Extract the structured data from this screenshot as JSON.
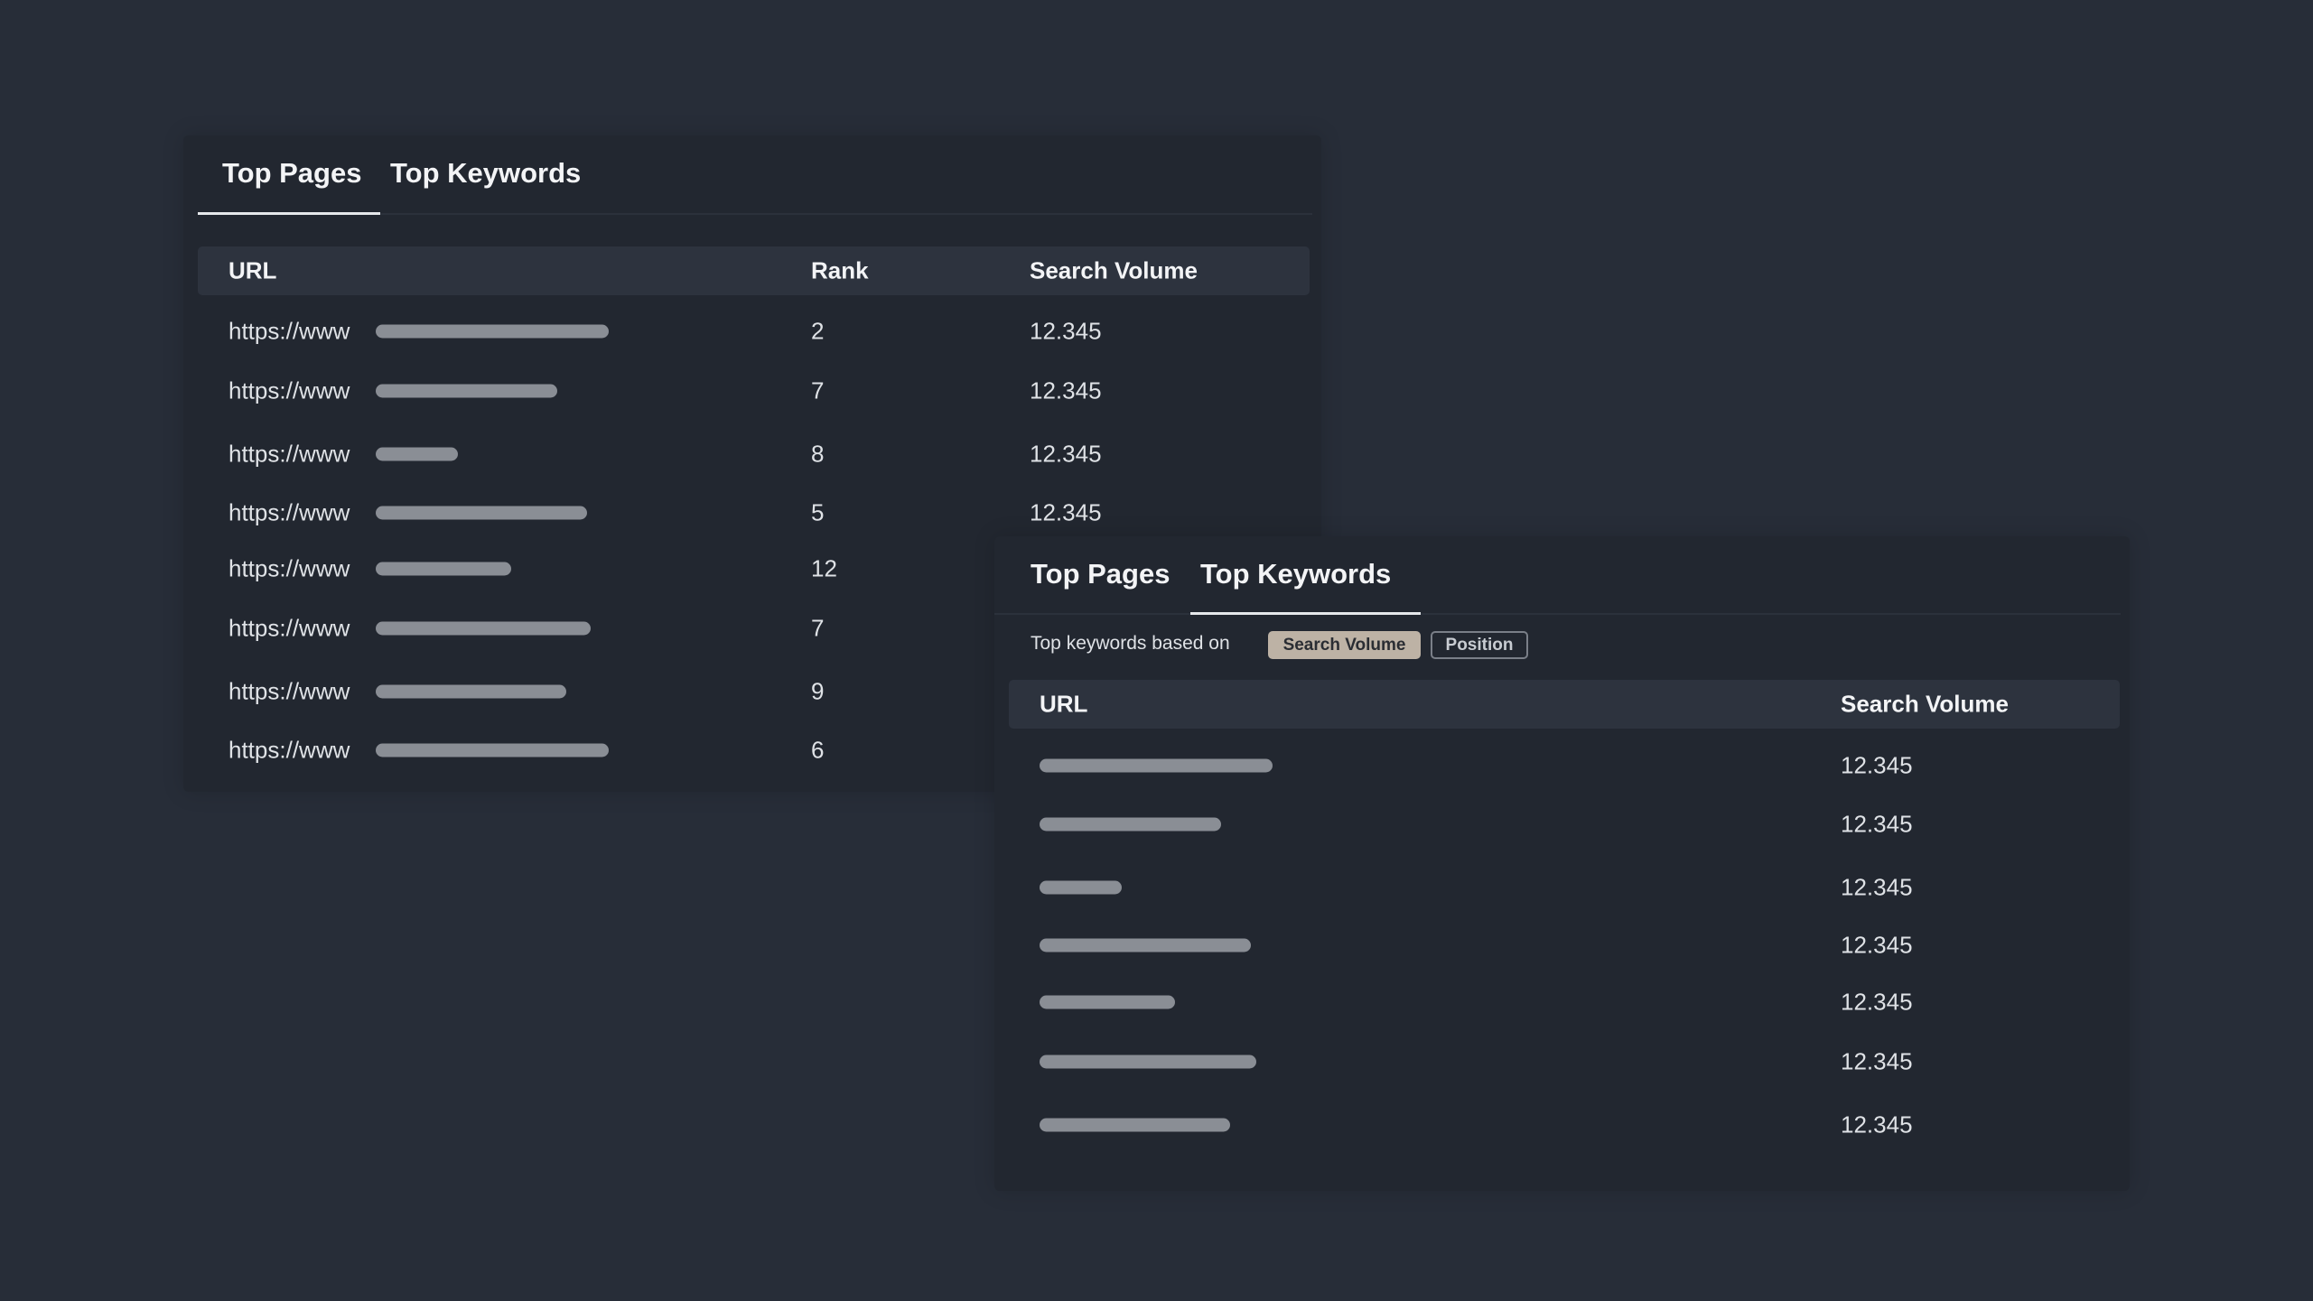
{
  "top_pages_panel": {
    "tabs": [
      {
        "label": "Top Pages",
        "active": true
      },
      {
        "label": "Top Keywords",
        "active": false
      }
    ],
    "columns": [
      "URL",
      "Rank",
      "Search Volume"
    ],
    "rows": [
      {
        "url": "https://www",
        "rank": "2",
        "volume": "12.345"
      },
      {
        "url": "https://www",
        "rank": "7",
        "volume": "12.345"
      },
      {
        "url": "https://www",
        "rank": "8",
        "volume": "12.345"
      },
      {
        "url": "https://www",
        "rank": "5",
        "volume": "12.345"
      },
      {
        "url": "https://www",
        "rank": "12"
      },
      {
        "url": "https://www",
        "rank": "7"
      },
      {
        "url": "https://www",
        "rank": "9"
      },
      {
        "url": "https://www",
        "rank": "6"
      }
    ]
  },
  "top_keywords_panel": {
    "tabs": [
      {
        "label": "Top Pages",
        "active": false
      },
      {
        "label": "Top Keywords",
        "active": true
      }
    ],
    "filter": {
      "label": "Top keywords based on",
      "options": [
        {
          "label": "Search Volume",
          "selected": true
        },
        {
          "label": "Position",
          "selected": false
        }
      ]
    },
    "columns": [
      "URL",
      "Search Volume"
    ],
    "rows": [
      {
        "volume": "12.345"
      },
      {
        "volume": "12.345"
      },
      {
        "volume": "12.345"
      },
      {
        "volume": "12.345"
      },
      {
        "volume": "12.345"
      },
      {
        "volume": "12.345"
      },
      {
        "volume": "12.345"
      }
    ]
  },
  "colors": {
    "background": "#272d38",
    "panel": "#222730",
    "header_row": "#2d333e",
    "selected_chip": "#bdb2a5",
    "skeleton_bar": "#8a8e95"
  }
}
